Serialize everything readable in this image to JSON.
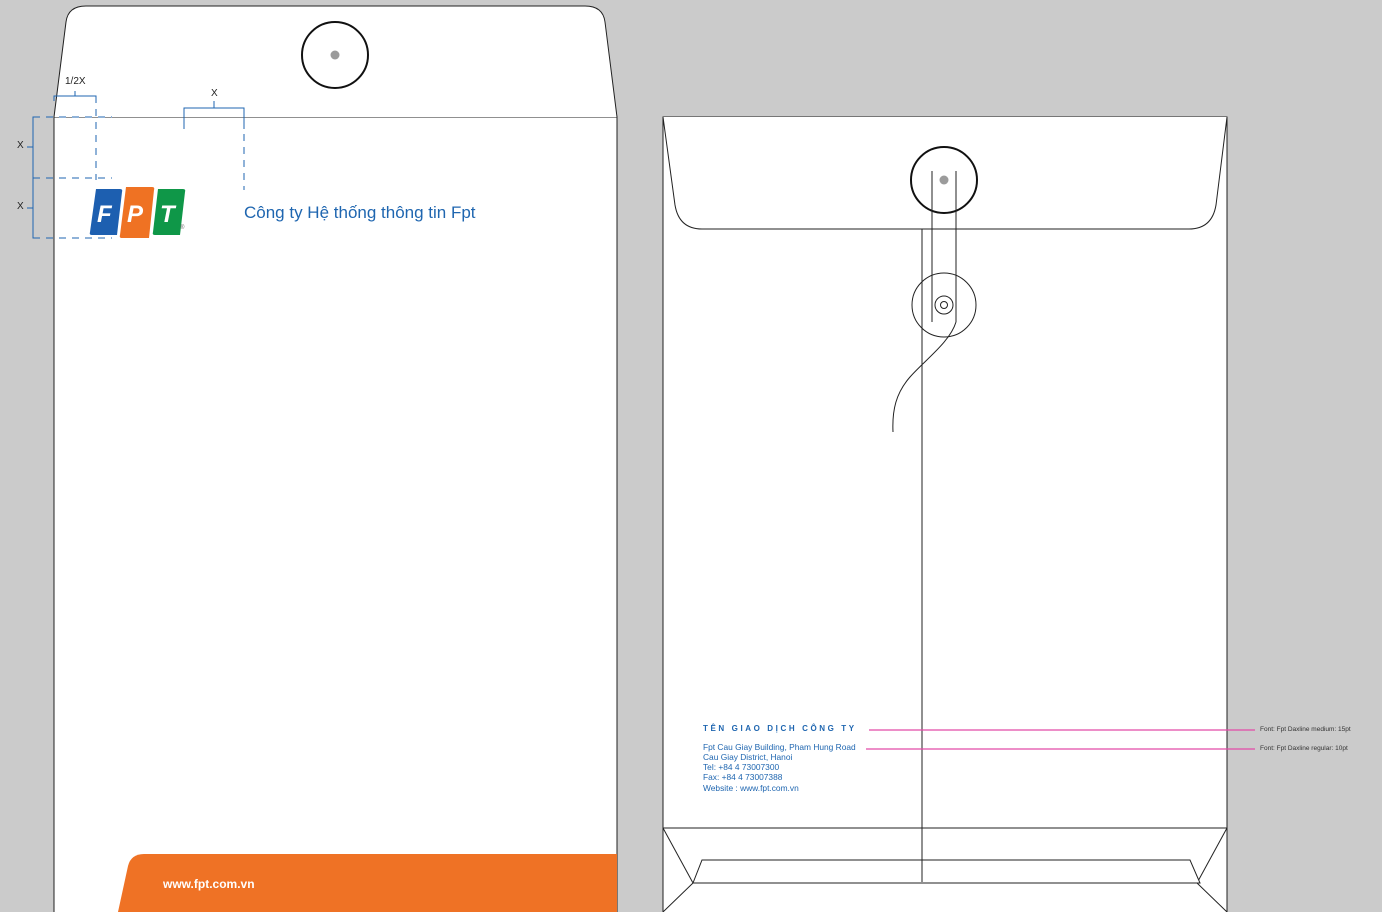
{
  "front": {
    "company_name": "Công ty Hệ thống thông tin Fpt",
    "website_band": "www.fpt.com.vn",
    "logo_letters": [
      "F",
      "P",
      "T"
    ],
    "logo_colors": [
      "#1d5fb0",
      "#ef7223",
      "#0f9748"
    ],
    "band_color": "#ef7225",
    "dimensions": {
      "half_x": "1/2X",
      "x_top": "X",
      "x_left_1": "X",
      "x_left_2": "X"
    }
  },
  "back": {
    "trade_name": "TÊN GIAO DỊCH CÔNG TY",
    "address_lines": [
      "Fpt Cau Giay Building, Pham Hung Road",
      "Cau Giay District, Hanoi",
      "Tel: +84 4 73007300",
      "Fax: +84 4 73007388",
      "Website : www.fpt.com.vn"
    ],
    "spec_notes": [
      "Font: Fpt Daxline medium: 15pt",
      "Font: Fpt Daxline regular: 10pt"
    ],
    "accent_color": "#1f66b0",
    "leader_color": "#e24aa8"
  }
}
